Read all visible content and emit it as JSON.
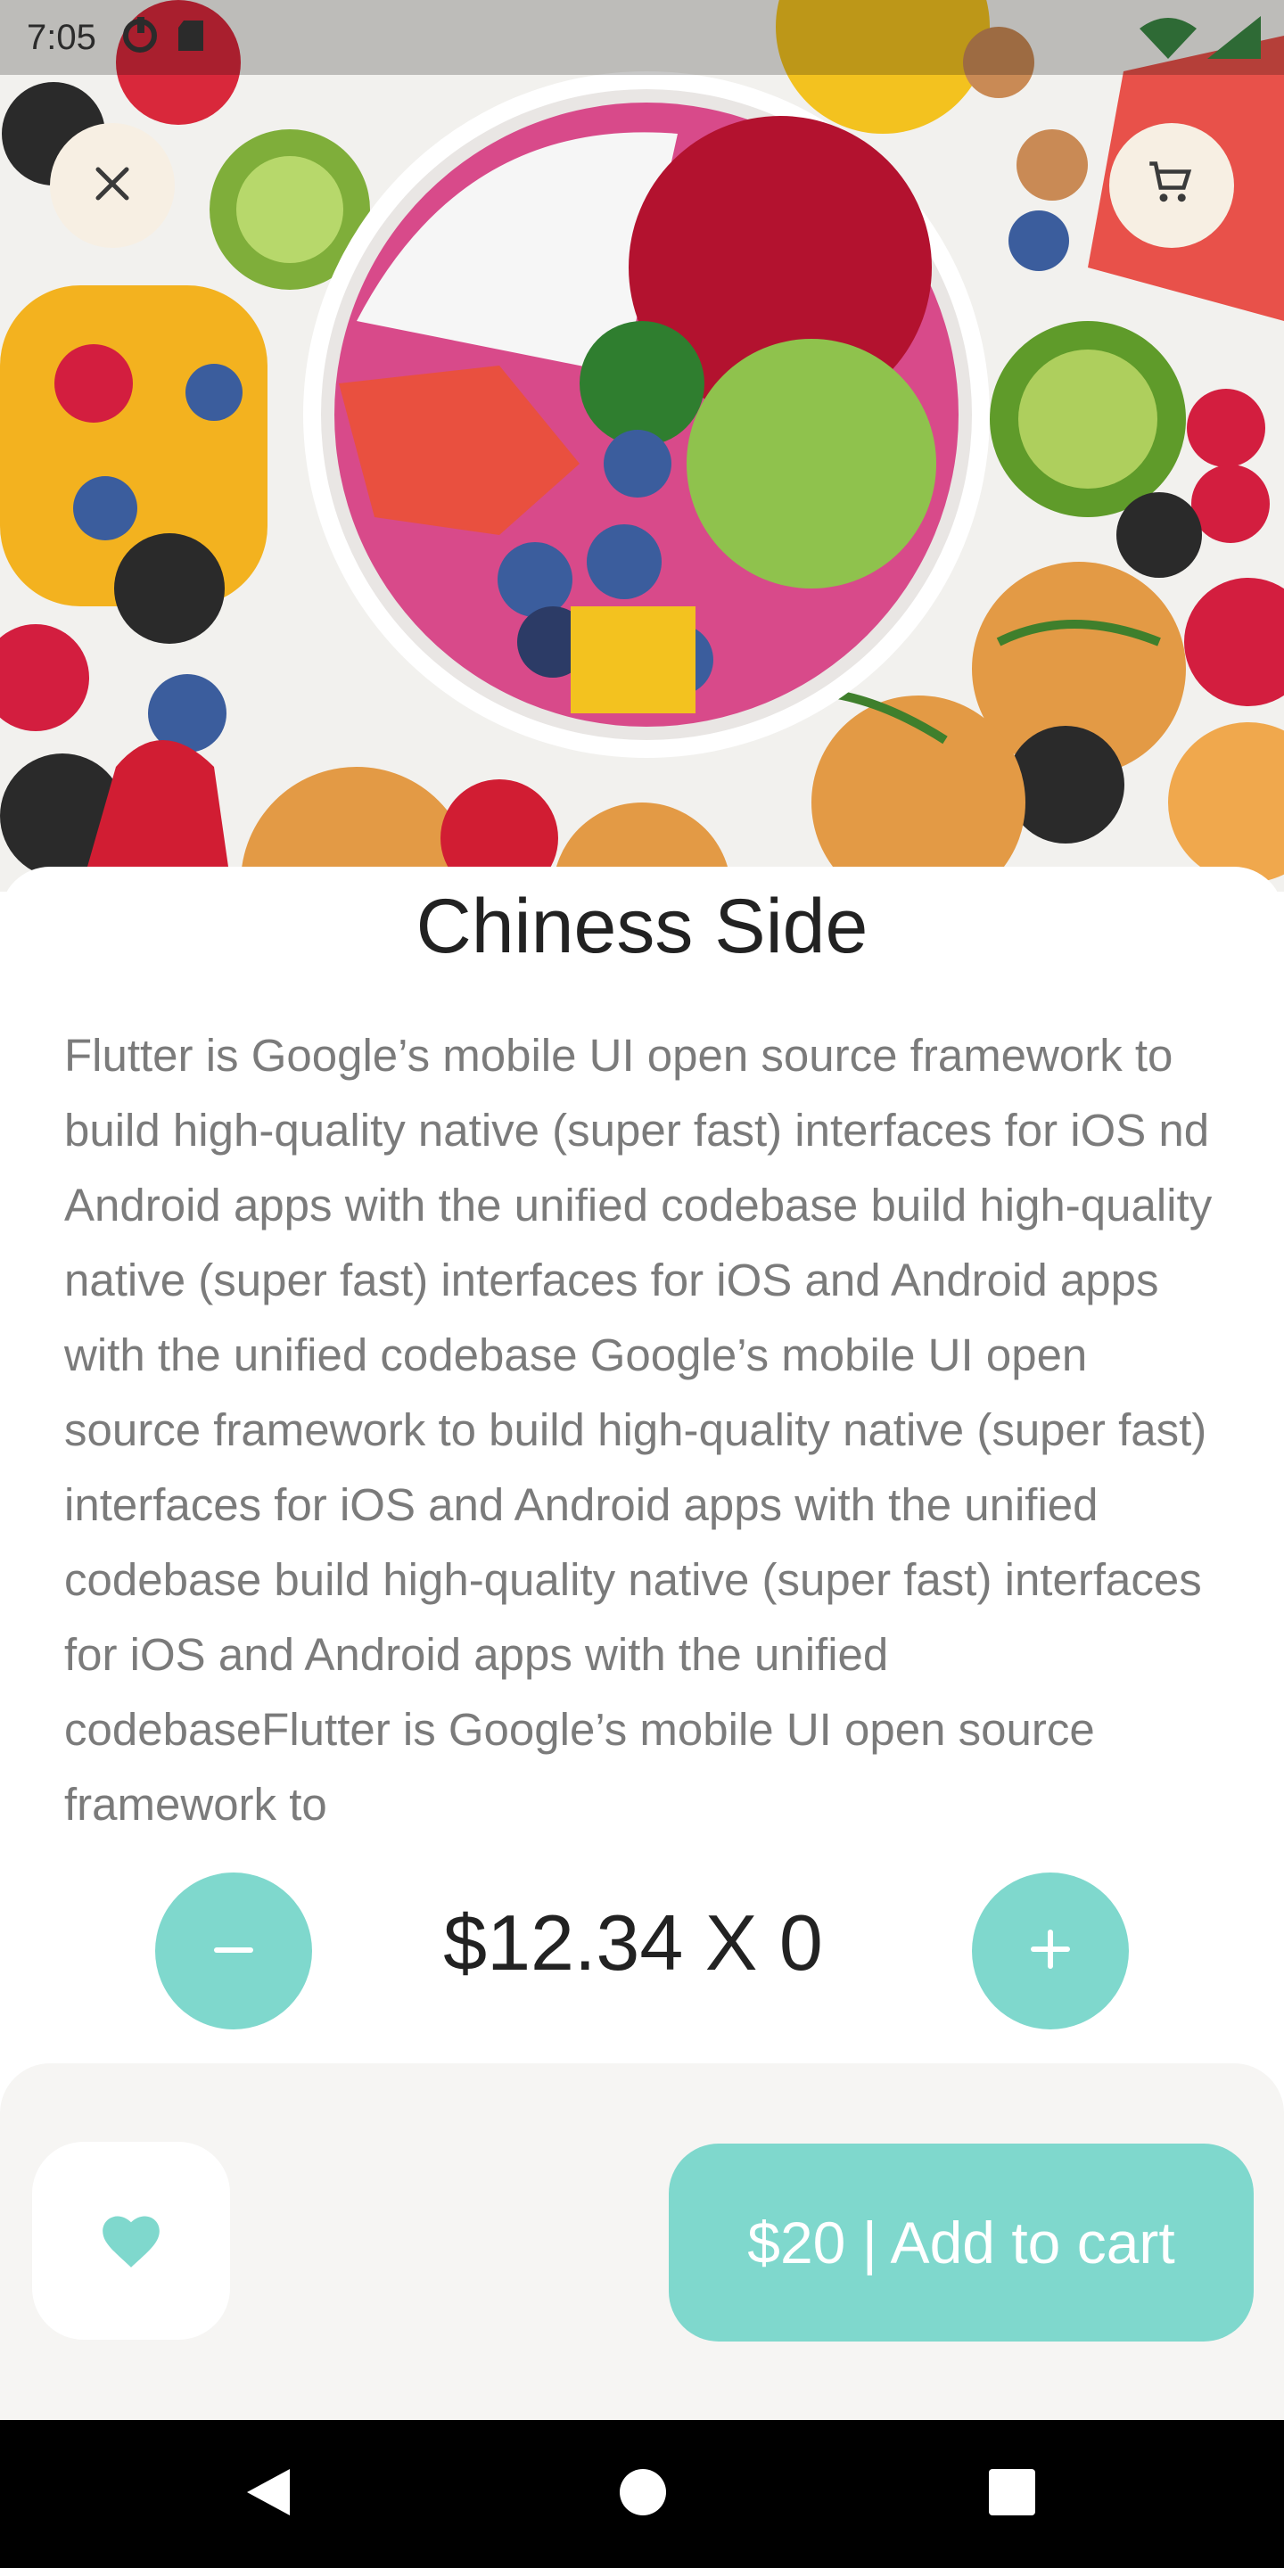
{
  "status_bar": {
    "time": "7:05"
  },
  "hero": {
    "image": "fruit-bowl-photo"
  },
  "top_buttons": {
    "close_icon": "close-icon",
    "cart_icon": "shopping-cart-icon"
  },
  "product": {
    "title": "Chiness Side",
    "description": "Flutter is Google’s mobile UI open source framework to build high-quality native (super fast) interfaces for iOS nd Android apps with the unified codebase build high-quality native (super fast) interfaces for iOS and Android apps with the unified codebase Google’s mobile UI open source framework to build high-quality native (super fast) interfaces for iOS and Android apps with the unified codebase build high-quality native (super fast) interfaces for iOS and Android apps with the unified codebaseFlutter is Google’s mobile UI open source framework to"
  },
  "quantity": {
    "label": "$12.34 X 0",
    "minus_icon": "minus-icon",
    "plus_icon": "plus-icon"
  },
  "actions": {
    "favorite_icon": "heart-icon",
    "add_to_cart_label": "$20 | Add to cart"
  },
  "colors": {
    "accent": "#7fd8cd",
    "bottom_panel": "#f6f5f3",
    "round_button": "#f7efe3",
    "text_primary": "#222222",
    "text_secondary": "#7b7b7b"
  }
}
